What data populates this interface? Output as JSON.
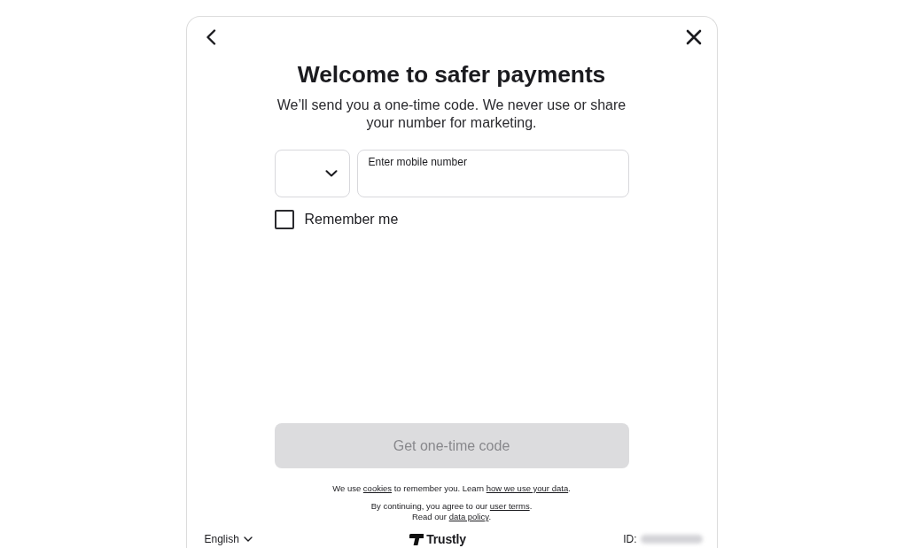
{
  "title": "Welcome to safer payments",
  "subtitle": "We’ll send you a one-time code. We never use or share your number for marketing.",
  "phone": {
    "placeholder": "Enter mobile number"
  },
  "remember_me": {
    "label": "Remember me",
    "checked": false
  },
  "submit": {
    "label": "Get one-time code",
    "disabled": true
  },
  "legal": [
    {
      "lines": [
        {
          "parts": [
            {
              "kind": "text",
              "text": "We use "
            },
            {
              "kind": "link",
              "text": "cookies"
            },
            {
              "kind": "text",
              "text": " to remember you. Learn "
            },
            {
              "kind": "link",
              "text": "how we use your data"
            },
            {
              "kind": "text",
              "text": "."
            }
          ]
        }
      ]
    },
    {
      "lines": [
        {
          "parts": [
            {
              "kind": "text",
              "text": "By continuing, you agree to our "
            },
            {
              "kind": "link",
              "text": "user terms"
            },
            {
              "kind": "text",
              "text": "."
            }
          ]
        },
        {
          "parts": [
            {
              "kind": "text",
              "text": "Read our "
            },
            {
              "kind": "link",
              "text": "data policy"
            },
            {
              "kind": "text",
              "text": "."
            }
          ]
        }
      ]
    }
  ],
  "footer": {
    "language": "English",
    "brand": "Trustly",
    "id_label": "ID:"
  }
}
